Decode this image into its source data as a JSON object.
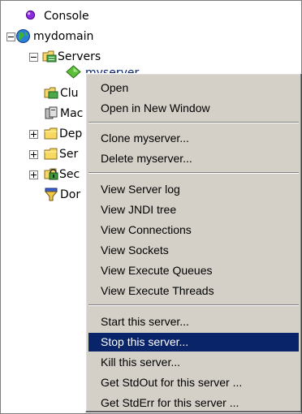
{
  "tree": {
    "console": "Console",
    "domain": "mydomain",
    "servers": "Servers",
    "server": "myserver",
    "clusters": "Clu",
    "machines": "Mac",
    "deployments": "Dep",
    "services": "Ser",
    "security": "Sec",
    "domain_log": "Dor"
  },
  "menu": {
    "open": "Open",
    "open_new_window": "Open in New Window",
    "clone": "Clone myserver...",
    "delete": "Delete myserver...",
    "view_log": "View Server log",
    "view_jndi": "View JNDI tree",
    "view_connections": "View Connections",
    "view_sockets": "View Sockets",
    "view_exec_queues": "View Execute Queues",
    "view_exec_threads": "View Execute Threads",
    "start": "Start this server...",
    "stop": "Stop this server...",
    "kill": "Kill this server...",
    "stdout": "Get StdOut for this server ...",
    "stderr": "Get StdErr for this server ..."
  },
  "colors": {
    "selection": "#0a246a",
    "menu_bg": "#d4d0c8"
  }
}
